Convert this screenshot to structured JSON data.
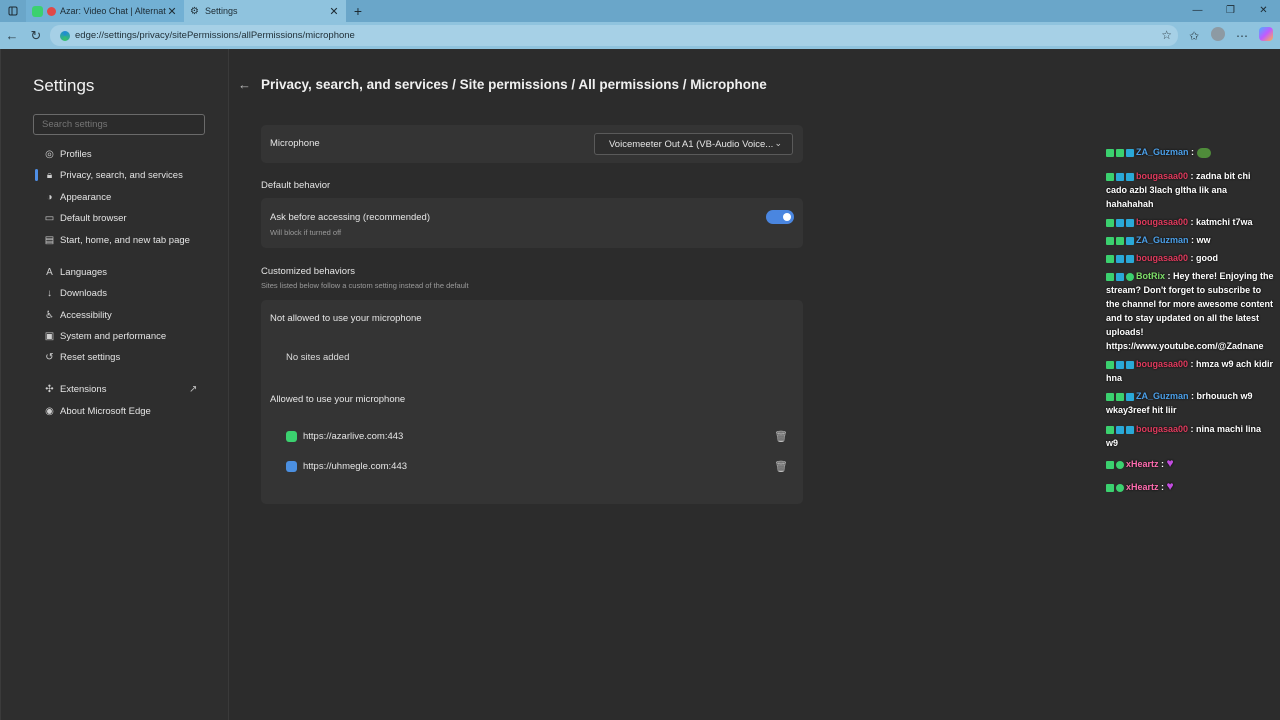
{
  "browser": {
    "tabs": [
      {
        "title": "Azar: Video Chat | Alternative",
        "color": "#3bd16f",
        "active": false
      },
      {
        "title": "Settings",
        "color": "#cfd8dc",
        "active": true
      }
    ],
    "new_tab": "+",
    "address": "edge://settings/privacy/sitePermissions/allPermissions/microphone"
  },
  "sidebar": {
    "title": "Settings",
    "search_placeholder": "Search settings",
    "items": [
      {
        "label": "Profiles",
        "icon": "profile-icon"
      },
      {
        "label": "Privacy, search, and services",
        "icon": "lock-icon"
      },
      {
        "label": "Appearance",
        "icon": "appearance-icon"
      },
      {
        "label": "Default browser",
        "icon": "browser-icon"
      },
      {
        "label": "Start, home, and new tab page",
        "icon": "home-icon"
      },
      {
        "label": "Languages",
        "icon": "languages-icon"
      },
      {
        "label": "Downloads",
        "icon": "download-icon"
      },
      {
        "label": "Accessibility",
        "icon": "accessibility-icon"
      },
      {
        "label": "System and performance",
        "icon": "system-icon"
      },
      {
        "label": "Reset settings",
        "icon": "reset-icon"
      },
      {
        "label": "Extensions",
        "icon": "extensions-icon"
      },
      {
        "label": "About Microsoft Edge",
        "icon": "edge-icon"
      }
    ]
  },
  "main": {
    "breadcrumb": "Privacy, search, and services / Site permissions / All permissions / Microphone",
    "microphone_label": "Microphone",
    "microphone_device": "Voicemeeter Out A1 (VB-Audio Voice...",
    "default_behavior_heading": "Default behavior",
    "ask_label": "Ask before accessing (recommended)",
    "ask_sub": "Will block if turned off",
    "ask_enabled": true,
    "custom_heading": "Customized behaviors",
    "custom_sub": "Sites listed below follow a custom setting instead of the default",
    "not_allowed_heading": "Not allowed to use your microphone",
    "not_allowed_empty": "No sites added",
    "allowed_heading": "Allowed to use your microphone",
    "allowed_sites": [
      {
        "url": "https://azarlive.com:443",
        "color": "#3bd16f"
      },
      {
        "url": "https://uhmegle.com:443",
        "color": "#4b8fe0"
      }
    ]
  },
  "chat": [
    {
      "nick": "ZA_Guzman",
      "color": "nick-blue",
      "text": ""
    },
    {
      "nick": "bougasaa00",
      "color": "nick-red",
      "text": "zadna bit chi cado azbl 3lach gltha lik ana hahahahah"
    },
    {
      "nick": "bougasaa00",
      "color": "nick-red",
      "text": "katmchi t7wa"
    },
    {
      "nick": "ZA_Guzman",
      "color": "nick-blue",
      "text": "ww"
    },
    {
      "nick": "bougasaa00",
      "color": "nick-red",
      "text": "good"
    },
    {
      "nick": "BotRix",
      "color": "nick-green",
      "text": "Hey there! Enjoying the stream? Don't forget to subscribe to the channel for more awesome content and to stay updated on all the latest uploads! https://www.youtube.com/@Zadnane"
    },
    {
      "nick": "bougasaa00",
      "color": "nick-red",
      "text": "hmza w9 ach kidir hna"
    },
    {
      "nick": "ZA_Guzman",
      "color": "nick-blue",
      "text": "brhouuch w9 wkay3reef hit liir"
    },
    {
      "nick": "bougasaa00",
      "color": "nick-red",
      "text": "nina machi lina w9"
    },
    {
      "nick": "xHeartz",
      "color": "nick-pink",
      "text": ""
    },
    {
      "nick": "xHeartz",
      "color": "nick-pink",
      "text": ""
    }
  ],
  "chat_separator": " : "
}
